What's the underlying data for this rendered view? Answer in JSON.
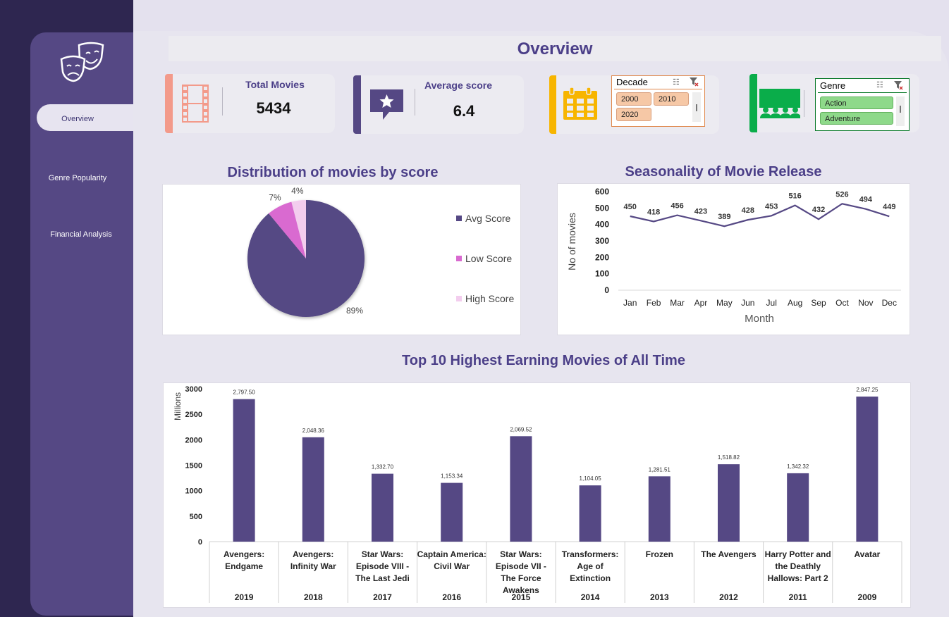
{
  "nav": {
    "items": [
      {
        "label": "Overview",
        "active": true
      },
      {
        "label": "Genre Popularity",
        "active": false
      },
      {
        "label": "Financial Analysis",
        "active": false
      }
    ]
  },
  "header": {
    "title": "Overview"
  },
  "kpis": {
    "total_movies": {
      "label": "Total Movies",
      "value": "5434",
      "icon": "film-strip-icon",
      "color": "#f39a8a"
    },
    "average_score": {
      "label": "Average score",
      "value": "6.4",
      "icon": "star-speech-bubble-icon",
      "color": "#554884"
    }
  },
  "slicers": {
    "decade": {
      "title": "Decade",
      "options": [
        "2000",
        "2010",
        "2020"
      ],
      "icon": "calendar-icon",
      "color": "#f7b500"
    },
    "genre": {
      "title": "Genre",
      "options": [
        "Action",
        "Adventure"
      ],
      "icon": "cinema-audience-icon",
      "color": "#0aad4a"
    }
  },
  "pie_section": {
    "title": "Distribution of movies by score"
  },
  "line_section": {
    "title": "Seasonality of Movie Release"
  },
  "bar_section": {
    "title": "Top 10 Highest Earning Movies of All Time"
  },
  "colors": {
    "accent": "#554884",
    "pink": "#d96ad0",
    "light_pink": "#f3cdee"
  },
  "chart_data": [
    {
      "type": "pie",
      "title": "Distribution of movies by score",
      "categories": [
        "Avg Score",
        "Low Score",
        "High Score"
      ],
      "values": [
        89,
        7,
        4
      ],
      "value_labels": [
        "89%",
        "7%",
        "4%"
      ],
      "colors": [
        "#554884",
        "#d96ad0",
        "#f3cdee"
      ],
      "legend": "right"
    },
    {
      "type": "line",
      "title": "Seasonality of Movie Release",
      "xlabel": "Month",
      "ylabel": "No of movies",
      "categories": [
        "Jan",
        "Feb",
        "Mar",
        "Apr",
        "May",
        "Jun",
        "Jul",
        "Aug",
        "Sep",
        "Oct",
        "Nov",
        "Dec"
      ],
      "values": [
        450,
        418,
        456,
        423,
        389,
        428,
        453,
        516,
        432,
        526,
        494,
        449
      ],
      "ylim": [
        0,
        600
      ],
      "yticks": [
        0,
        100,
        200,
        300,
        400,
        500,
        600
      ],
      "grid": false
    },
    {
      "type": "bar",
      "title": "Top 10 Highest Earning Movies of All Time",
      "ylabel": "Millions",
      "categories": [
        {
          "name": "Avengers: Endgame",
          "year": "2019"
        },
        {
          "name": "Avengers: Infinity War",
          "year": "2018"
        },
        {
          "name": "Star Wars: Episode VIII - The Last Jedi",
          "year": "2017"
        },
        {
          "name": "Captain America: Civil War",
          "year": "2016"
        },
        {
          "name": "Star Wars: Episode VII - The Force Awakens",
          "year": "2015"
        },
        {
          "name": "Transformers: Age of Extinction",
          "year": "2014"
        },
        {
          "name": "Frozen",
          "year": "2013"
        },
        {
          "name": "The Avengers",
          "year": "2012"
        },
        {
          "name": "Harry Potter and the Deathly Hallows: Part 2",
          "year": "2011"
        },
        {
          "name": "Avatar",
          "year": "2009"
        }
      ],
      "values": [
        2797.5,
        2048.36,
        1332.7,
        1153.34,
        2069.52,
        1104.05,
        1281.51,
        1518.82,
        1342.32,
        2847.25
      ],
      "value_labels": [
        "2,797.50",
        "2,048.36",
        "1,332.70",
        "1,153.34",
        "2,069.52",
        "1,104.05",
        "1,281.51",
        "1,518.82",
        "1,342.32",
        "2,847.25"
      ],
      "ylim": [
        0,
        3000
      ],
      "yticks": [
        0,
        500,
        1000,
        1500,
        2000,
        2500,
        3000
      ],
      "grid": false
    }
  ]
}
